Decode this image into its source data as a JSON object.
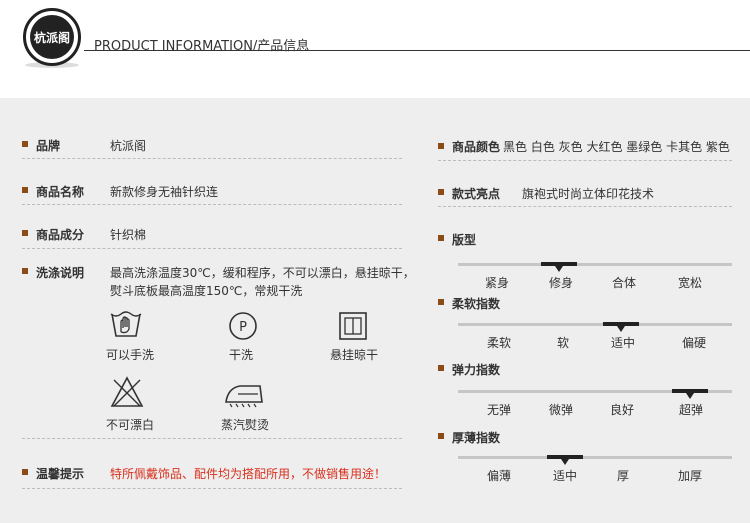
{
  "header": {
    "logo_text": "杭派阁",
    "title": "PRODUCT INFORMATION/产品信息"
  },
  "left": {
    "brand": {
      "label": "品牌",
      "value": "杭派阁"
    },
    "name": {
      "label": "商品名称",
      "value": "新款修身无袖针织连"
    },
    "material": {
      "label": "商品成分",
      "value": "针织棉"
    },
    "wash": {
      "label": "洗涤说明",
      "line1": "最高洗涤温度30℃，缓和程序，不可以漂白，悬挂晾干，",
      "line2": "熨斗底板最高温度150℃，常规干洗"
    },
    "care": [
      {
        "icon": "hand-wash-icon",
        "label": "可以手洗"
      },
      {
        "icon": "dry-clean-icon",
        "label": "干洗"
      },
      {
        "icon": "hang-dry-icon",
        "label": "悬挂晾干"
      },
      {
        "icon": "no-bleach-icon",
        "label": "不可漂白"
      },
      {
        "icon": "steam-iron-icon",
        "label": "蒸汽熨烫"
      }
    ],
    "tip": {
      "label": "温馨提示",
      "value": "特所佩戴饰品、配件均为搭配所用，不做销售用途！"
    }
  },
  "right": {
    "colors": {
      "label": "商品颜色",
      "value": "黑色 白色 灰色 大红色 墨绿色 卡其色 紫色"
    },
    "style": {
      "label": "款式亮点",
      "value": "旗袍式时尚立体印花技术"
    },
    "fit": {
      "label": "版型",
      "options": [
        "紧身",
        "修身",
        "合体",
        "宽松"
      ],
      "selected": 1
    },
    "softness": {
      "label": "柔软指数",
      "options": [
        "柔软",
        "软",
        "适中",
        "偏硬"
      ],
      "selected": 2
    },
    "elasticity": {
      "label": "弹力指数",
      "options": [
        "无弹",
        "微弹",
        "良好",
        "超弹"
      ],
      "selected": 3
    },
    "thickness": {
      "label": "厚薄指数",
      "options": [
        "偏薄",
        "适中",
        "厚",
        "加厚"
      ],
      "selected": 1
    }
  }
}
